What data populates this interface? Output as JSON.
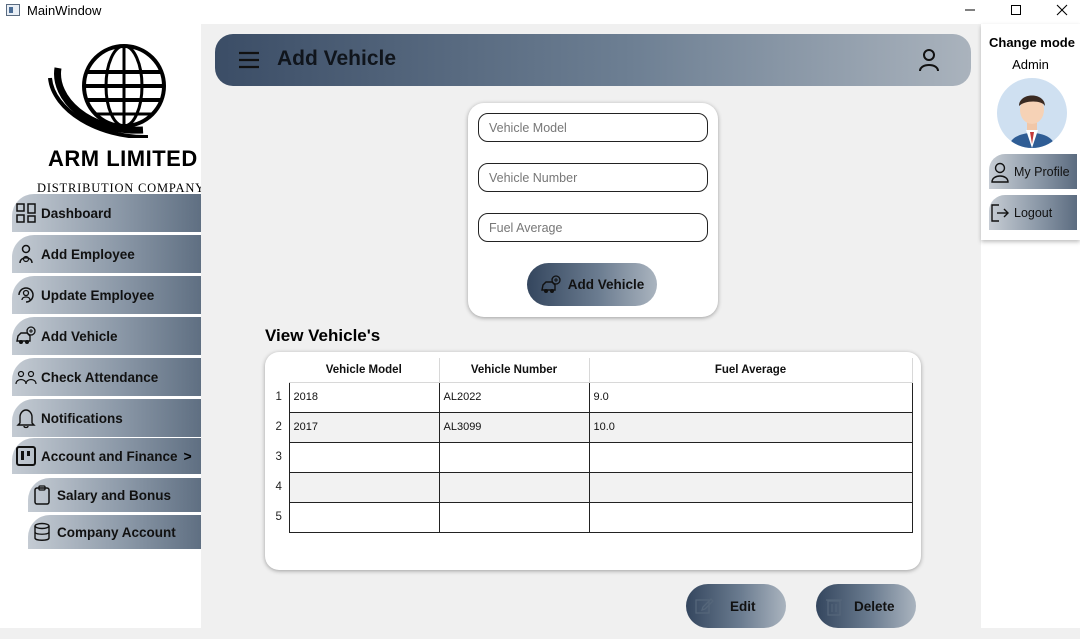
{
  "window": {
    "title": "MainWindow"
  },
  "brand": {
    "name": "ARM LIMITED",
    "subtitle": "DISTRIBUTION COMPANY"
  },
  "sidebar": {
    "items": [
      {
        "label": "Dashboard",
        "icon": "dashboard-icon"
      },
      {
        "label": "Add Employee",
        "icon": "add-employee-icon"
      },
      {
        "label": "Update Employee",
        "icon": "update-employee-icon"
      },
      {
        "label": "Add Vehicle",
        "icon": "add-vehicle-icon"
      },
      {
        "label": "Check Attendance",
        "icon": "attendance-icon"
      },
      {
        "label": "Notifications",
        "icon": "bell-icon"
      },
      {
        "label": "Account and Finance",
        "icon": "finance-icon",
        "chevron": ">"
      }
    ],
    "subitems": [
      {
        "label": "Salary and Bonus",
        "icon": "clipboard-icon"
      },
      {
        "label": "Company Account",
        "icon": "database-icon"
      }
    ]
  },
  "header": {
    "title": "Add Vehicle"
  },
  "form": {
    "model_placeholder": "Vehicle Model",
    "number_placeholder": "Vehicle Number",
    "fuel_placeholder": "Fuel Average",
    "submit_label": "Add Vehicle"
  },
  "table": {
    "title": "View Vehicle's",
    "columns": [
      "Vehicle Model",
      "Vehicle Number",
      "Fuel Average"
    ],
    "rows": [
      {
        "n": "1",
        "model": "2018",
        "number": "AL2022",
        "fuel": "9.0"
      },
      {
        "n": "2",
        "model": "2017",
        "number": "AL3099",
        "fuel": "10.0"
      },
      {
        "n": "3",
        "model": "",
        "number": "",
        "fuel": ""
      },
      {
        "n": "4",
        "model": "",
        "number": "",
        "fuel": ""
      },
      {
        "n": "5",
        "model": "",
        "number": "",
        "fuel": ""
      }
    ]
  },
  "actions": {
    "edit_label": "Edit",
    "delete_label": "Delete"
  },
  "right_panel": {
    "mode_label": "Change mode",
    "role": "Admin",
    "profile_label": "My Profile",
    "logout_label": "Logout"
  },
  "colors": {
    "accent_dark": "#3b4d66",
    "accent_light": "#aab3bd"
  }
}
